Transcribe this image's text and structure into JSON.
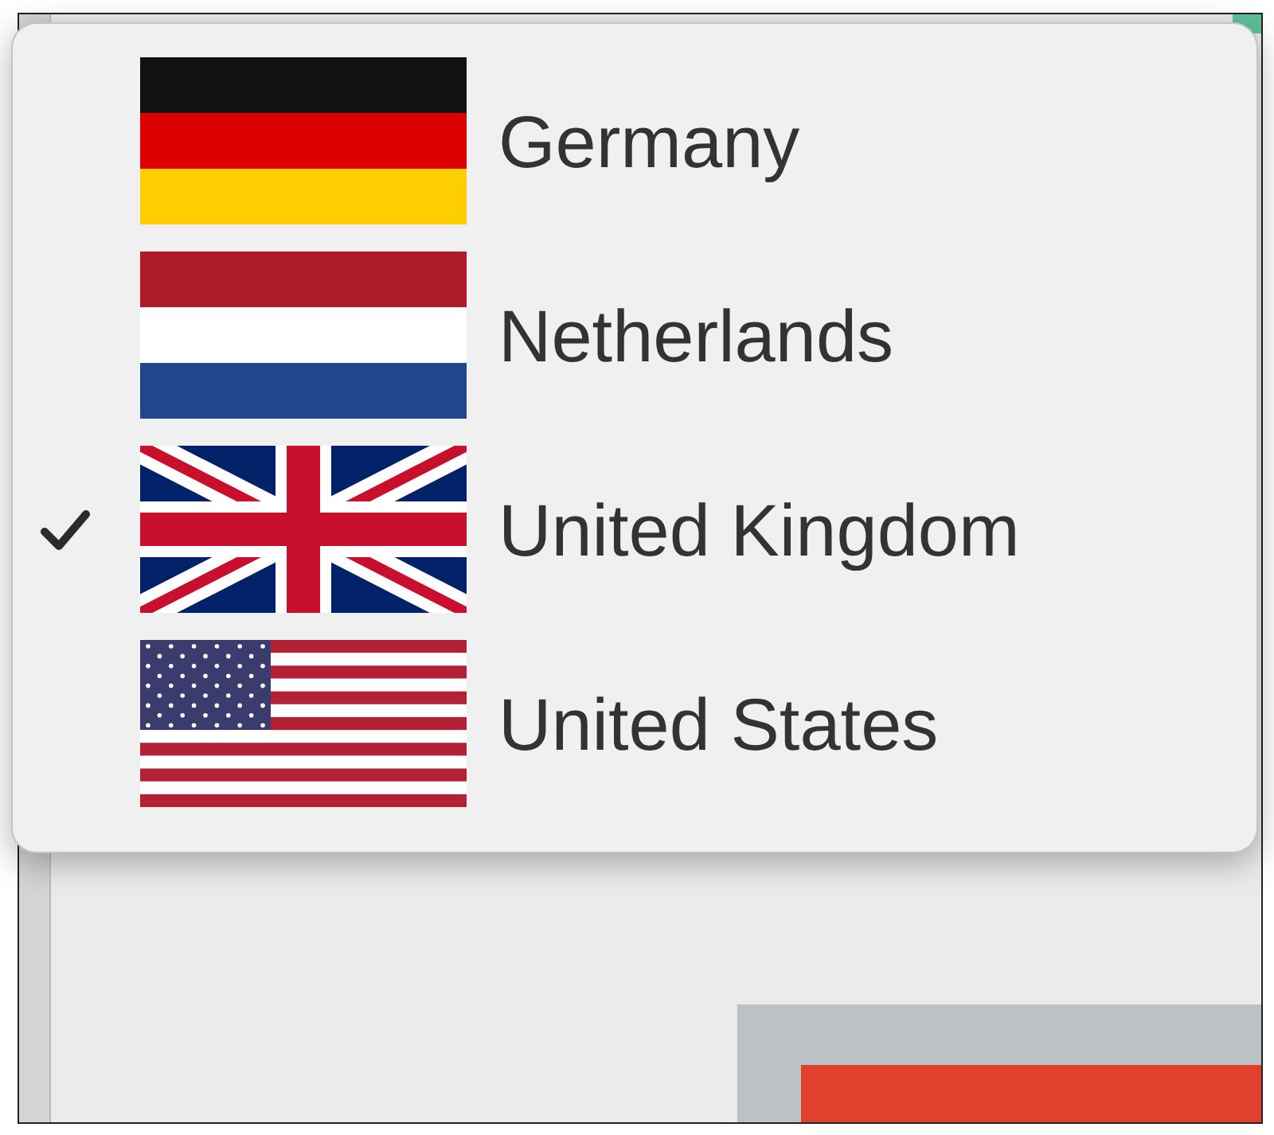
{
  "menu": {
    "items": [
      {
        "label": "Germany",
        "kind": "de",
        "selected": false
      },
      {
        "label": "Netherlands",
        "kind": "nl",
        "selected": false
      },
      {
        "label": "United Kingdom",
        "kind": "uk",
        "selected": true
      },
      {
        "label": "United States",
        "kind": "us",
        "selected": false
      }
    ]
  }
}
